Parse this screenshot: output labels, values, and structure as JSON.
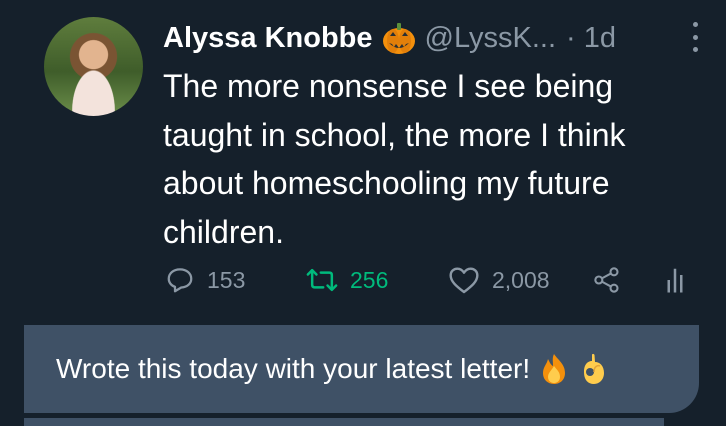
{
  "tweet": {
    "author_name": "Alyssa Knobbe",
    "handle": "@LyssK...",
    "separator": "·",
    "time": "1d",
    "text": "The more nonsense I see being taught in school, the more I think about homeschooling my future children.",
    "name_emoji_icon": "jack-o-lantern-icon",
    "actions": {
      "reply_count": "153",
      "retweet_count": "256",
      "like_count": "2,008"
    }
  },
  "reply": {
    "text": "Wrote this today with your latest letter!",
    "emoji_icons": [
      "fire-icon",
      "ok-hand-icon"
    ]
  },
  "colors": {
    "background": "#15202b",
    "secondary_text": "#8b98a5",
    "retweet_green": "#00ba7c",
    "reply_box": "#3f5166"
  }
}
